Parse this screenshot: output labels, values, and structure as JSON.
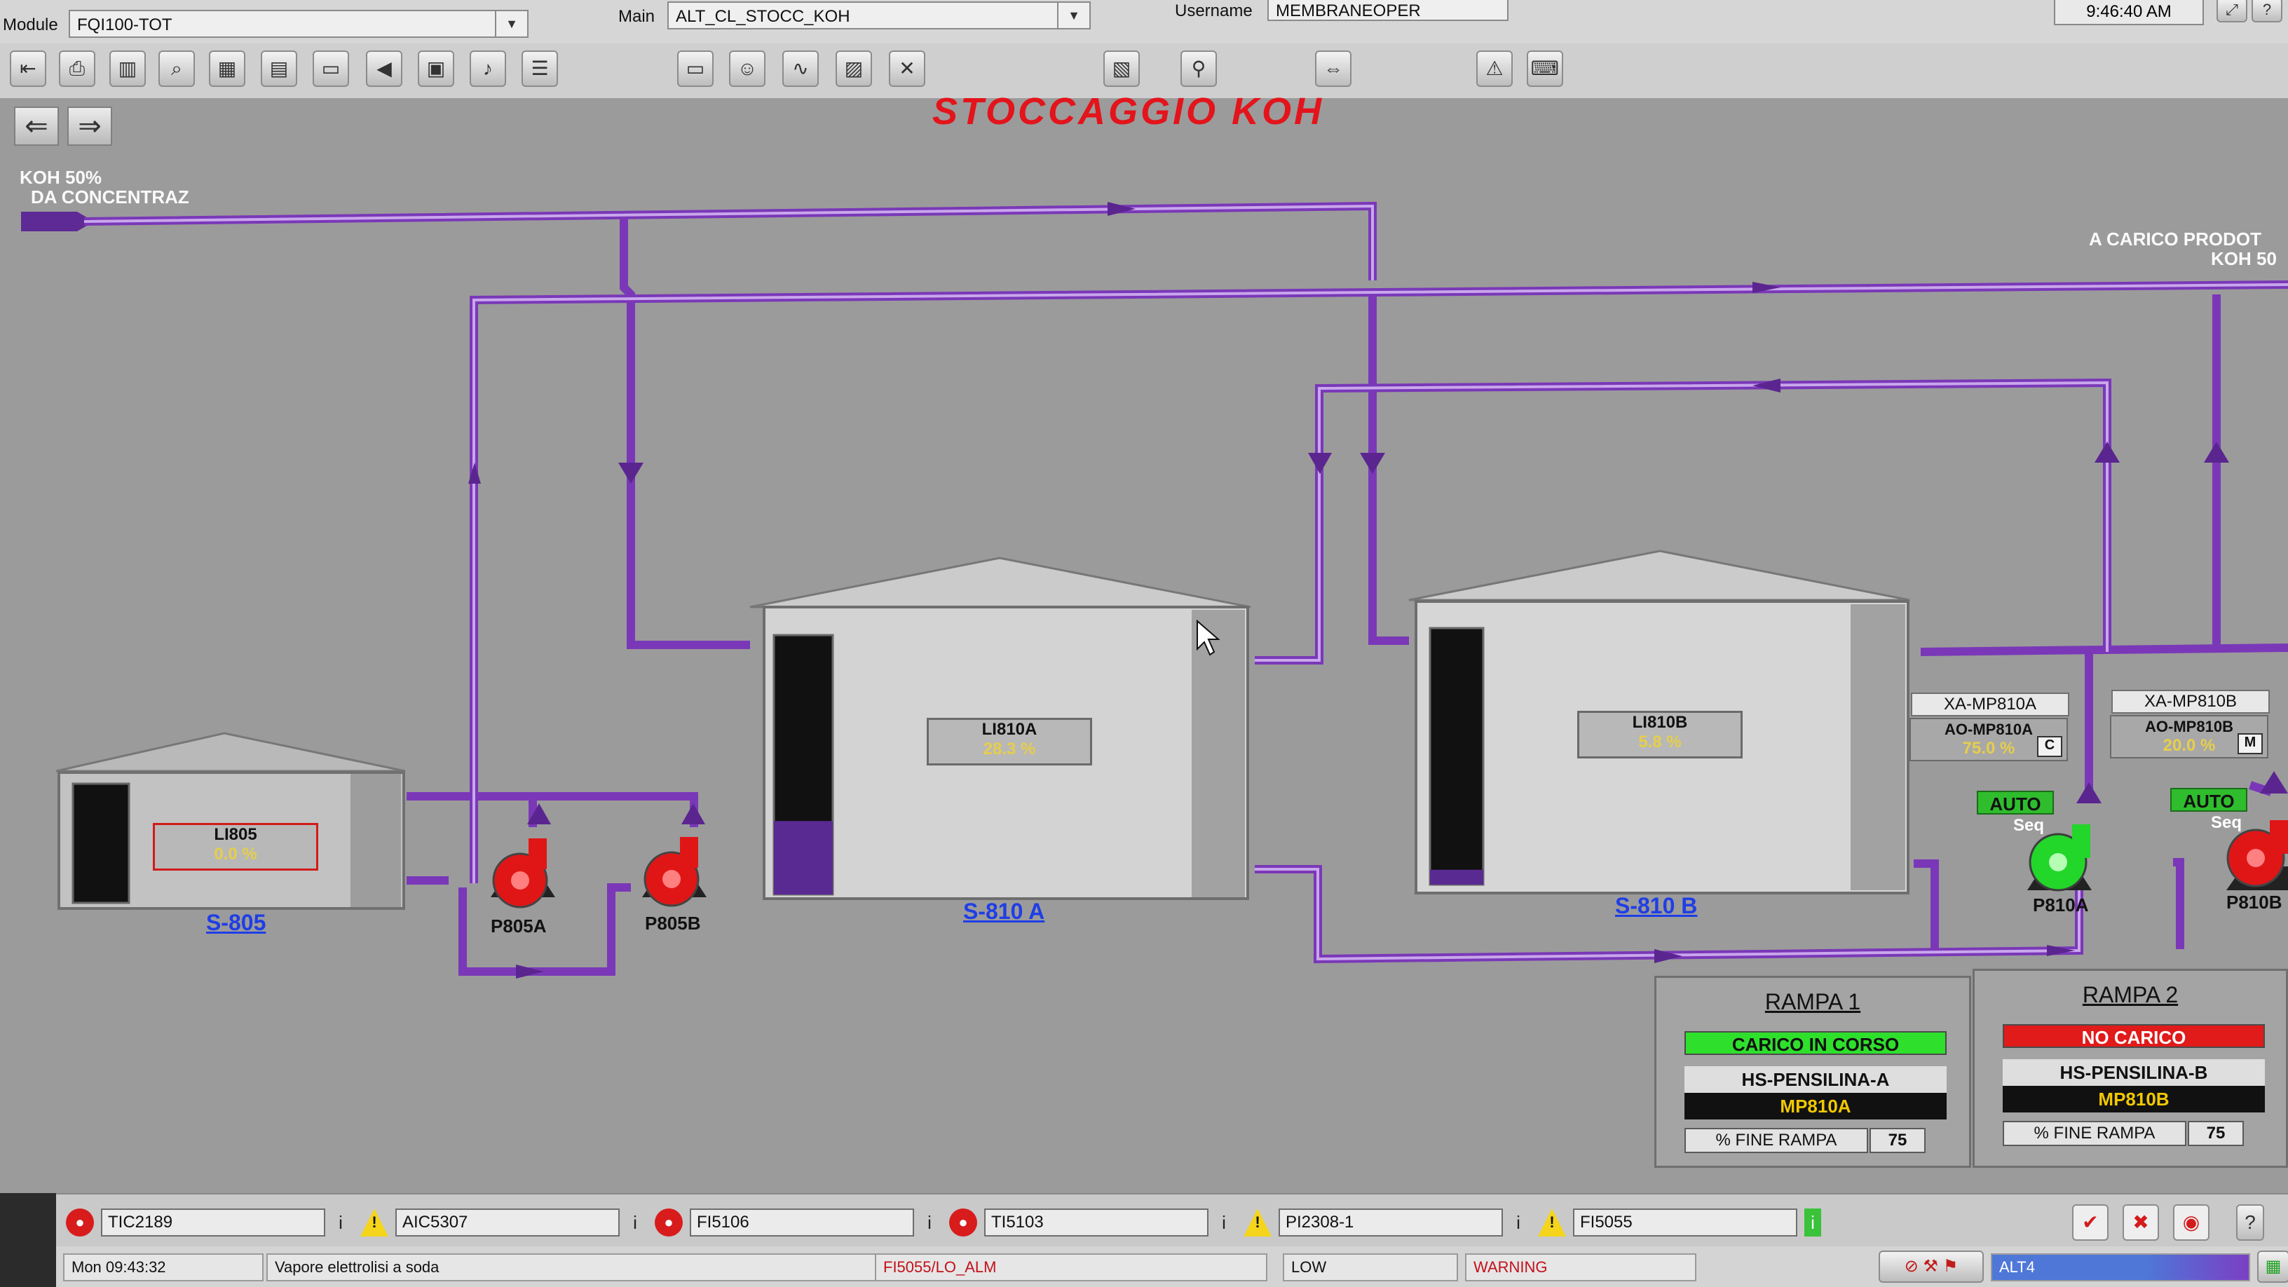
{
  "header": {
    "module_label": "Module",
    "module_value": "FQI100-TOT",
    "main_label": "Main",
    "main_value": "ALT_CL_STOCC_KOH",
    "username_label": "Username",
    "username_value": "MEMBRANEOPER",
    "clock": "9:46:40 AM"
  },
  "toolbar": {
    "icons": [
      "back-arrow-icon",
      "printer-icon",
      "bars-icon",
      "zoom-icon",
      "grid-icon",
      "trend-icon",
      "folder-icon",
      "left-arrow-icon",
      "window-icon",
      "bell-icon",
      "list-icon",
      "monitor-icon",
      "users-icon",
      "waveform-icon",
      "chart-icon",
      "tools-icon",
      "document-icon",
      "search-person-icon",
      "screen-share-icon",
      "alarm-bell-icon",
      "keyboard-icon"
    ]
  },
  "page": {
    "title": "STOCCAGGIO KOH",
    "inlet_label_line1": "KOH 50%",
    "inlet_label_line2": "DA CONCENTRAZ",
    "outlet_label_line1": "A CARICO PRODOT",
    "outlet_label_line2": "KOH 50"
  },
  "tanks": [
    {
      "name": "S-805",
      "tag": "LI805",
      "value": "0.0 %",
      "level": 0.0
    },
    {
      "name": "S-810 A",
      "tag": "LI810A",
      "value": "28.3 %",
      "level": 0.283
    },
    {
      "name": "S-810 B",
      "tag": "LI810B",
      "value": "5.8 %",
      "level": 0.058
    }
  ],
  "pumps": [
    {
      "name": "P805A",
      "color": "#e01616"
    },
    {
      "name": "P805B",
      "color": "#e01616"
    },
    {
      "name": "P810A",
      "color": "#22d62a"
    },
    {
      "name": "P810B",
      "color": "#e01616"
    }
  ],
  "pump_controls": [
    {
      "xa": "XA-MP810A",
      "ao": "AO-MP810A",
      "ao_value": "75.0 %",
      "mode_letter": "C",
      "auto": "AUTO",
      "seq": "Seq"
    },
    {
      "xa": "XA-MP810B",
      "ao": "AO-MP810B",
      "ao_value": "20.0 %",
      "mode_letter": "M",
      "auto": "AUTO",
      "seq": "Seq"
    }
  ],
  "rampe": [
    {
      "title": "RAMPA 1",
      "status": "CARICO IN CORSO",
      "status_color": "#2ee02c",
      "hs": "HS-PENSILINA-A",
      "pump": "MP810A",
      "fine_label": "% FINE RAMPA",
      "fine_value": "75"
    },
    {
      "title": "RAMPA 2",
      "status": "NO CARICO",
      "status_color": "#e11a1a",
      "hs": "HS-PENSILINA-B",
      "pump": "MP810B",
      "fine_label": "% FINE RAMPA",
      "fine_value": "75"
    }
  ],
  "alarms": [
    {
      "tag": "TIC2189",
      "icon": "alarm-red-icon"
    },
    {
      "tag": "AIC5307",
      "icon": "warning-icon"
    },
    {
      "tag": "FI5106",
      "icon": "alarm-red-icon"
    },
    {
      "tag": "TI5103",
      "icon": "alarm-red-icon"
    },
    {
      "tag": "PI2308-1",
      "icon": "warning-icon"
    },
    {
      "tag": "FI5055",
      "icon": "warning-icon"
    }
  ],
  "alarm_info_symbol": "i",
  "status_line": {
    "datetime": "Mon 09:43:32",
    "message": "Vapore elettrolisi a soda",
    "alarm_tag": "FI5055/LO_ALM",
    "level": "LOW",
    "severity": "WARNING",
    "area": "ALT4"
  }
}
